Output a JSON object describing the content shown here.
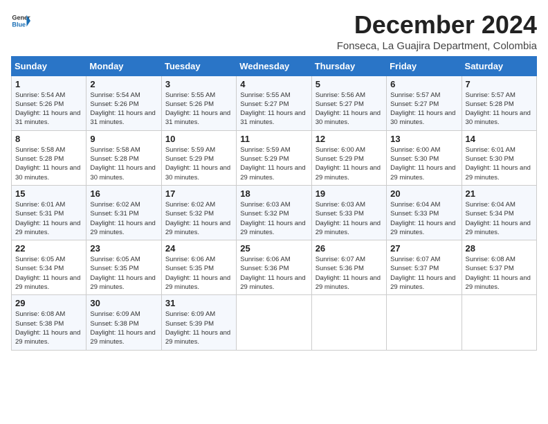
{
  "logo": {
    "line1": "General",
    "line2": "Blue"
  },
  "title": "December 2024",
  "subtitle": "Fonseca, La Guajira Department, Colombia",
  "weekdays": [
    "Sunday",
    "Monday",
    "Tuesday",
    "Wednesday",
    "Thursday",
    "Friday",
    "Saturday"
  ],
  "weeks": [
    [
      {
        "day": "1",
        "sunrise": "5:54 AM",
        "sunset": "5:26 PM",
        "daylight": "11 hours and 31 minutes."
      },
      {
        "day": "2",
        "sunrise": "5:54 AM",
        "sunset": "5:26 PM",
        "daylight": "11 hours and 31 minutes."
      },
      {
        "day": "3",
        "sunrise": "5:55 AM",
        "sunset": "5:26 PM",
        "daylight": "11 hours and 31 minutes."
      },
      {
        "day": "4",
        "sunrise": "5:55 AM",
        "sunset": "5:27 PM",
        "daylight": "11 hours and 31 minutes."
      },
      {
        "day": "5",
        "sunrise": "5:56 AM",
        "sunset": "5:27 PM",
        "daylight": "11 hours and 30 minutes."
      },
      {
        "day": "6",
        "sunrise": "5:57 AM",
        "sunset": "5:27 PM",
        "daylight": "11 hours and 30 minutes."
      },
      {
        "day": "7",
        "sunrise": "5:57 AM",
        "sunset": "5:28 PM",
        "daylight": "11 hours and 30 minutes."
      }
    ],
    [
      {
        "day": "8",
        "sunrise": "5:58 AM",
        "sunset": "5:28 PM",
        "daylight": "11 hours and 30 minutes."
      },
      {
        "day": "9",
        "sunrise": "5:58 AM",
        "sunset": "5:28 PM",
        "daylight": "11 hours and 30 minutes."
      },
      {
        "day": "10",
        "sunrise": "5:59 AM",
        "sunset": "5:29 PM",
        "daylight": "11 hours and 30 minutes."
      },
      {
        "day": "11",
        "sunrise": "5:59 AM",
        "sunset": "5:29 PM",
        "daylight": "11 hours and 29 minutes."
      },
      {
        "day": "12",
        "sunrise": "6:00 AM",
        "sunset": "5:29 PM",
        "daylight": "11 hours and 29 minutes."
      },
      {
        "day": "13",
        "sunrise": "6:00 AM",
        "sunset": "5:30 PM",
        "daylight": "11 hours and 29 minutes."
      },
      {
        "day": "14",
        "sunrise": "6:01 AM",
        "sunset": "5:30 PM",
        "daylight": "11 hours and 29 minutes."
      }
    ],
    [
      {
        "day": "15",
        "sunrise": "6:01 AM",
        "sunset": "5:31 PM",
        "daylight": "11 hours and 29 minutes."
      },
      {
        "day": "16",
        "sunrise": "6:02 AM",
        "sunset": "5:31 PM",
        "daylight": "11 hours and 29 minutes."
      },
      {
        "day": "17",
        "sunrise": "6:02 AM",
        "sunset": "5:32 PM",
        "daylight": "11 hours and 29 minutes."
      },
      {
        "day": "18",
        "sunrise": "6:03 AM",
        "sunset": "5:32 PM",
        "daylight": "11 hours and 29 minutes."
      },
      {
        "day": "19",
        "sunrise": "6:03 AM",
        "sunset": "5:33 PM",
        "daylight": "11 hours and 29 minutes."
      },
      {
        "day": "20",
        "sunrise": "6:04 AM",
        "sunset": "5:33 PM",
        "daylight": "11 hours and 29 minutes."
      },
      {
        "day": "21",
        "sunrise": "6:04 AM",
        "sunset": "5:34 PM",
        "daylight": "11 hours and 29 minutes."
      }
    ],
    [
      {
        "day": "22",
        "sunrise": "6:05 AM",
        "sunset": "5:34 PM",
        "daylight": "11 hours and 29 minutes."
      },
      {
        "day": "23",
        "sunrise": "6:05 AM",
        "sunset": "5:35 PM",
        "daylight": "11 hours and 29 minutes."
      },
      {
        "day": "24",
        "sunrise": "6:06 AM",
        "sunset": "5:35 PM",
        "daylight": "11 hours and 29 minutes."
      },
      {
        "day": "25",
        "sunrise": "6:06 AM",
        "sunset": "5:36 PM",
        "daylight": "11 hours and 29 minutes."
      },
      {
        "day": "26",
        "sunrise": "6:07 AM",
        "sunset": "5:36 PM",
        "daylight": "11 hours and 29 minutes."
      },
      {
        "day": "27",
        "sunrise": "6:07 AM",
        "sunset": "5:37 PM",
        "daylight": "11 hours and 29 minutes."
      },
      {
        "day": "28",
        "sunrise": "6:08 AM",
        "sunset": "5:37 PM",
        "daylight": "11 hours and 29 minutes."
      }
    ],
    [
      {
        "day": "29",
        "sunrise": "6:08 AM",
        "sunset": "5:38 PM",
        "daylight": "11 hours and 29 minutes."
      },
      {
        "day": "30",
        "sunrise": "6:09 AM",
        "sunset": "5:38 PM",
        "daylight": "11 hours and 29 minutes."
      },
      {
        "day": "31",
        "sunrise": "6:09 AM",
        "sunset": "5:39 PM",
        "daylight": "11 hours and 29 minutes."
      },
      null,
      null,
      null,
      null
    ]
  ],
  "labels": {
    "sunrise": "Sunrise:",
    "sunset": "Sunset:",
    "daylight": "Daylight:"
  }
}
